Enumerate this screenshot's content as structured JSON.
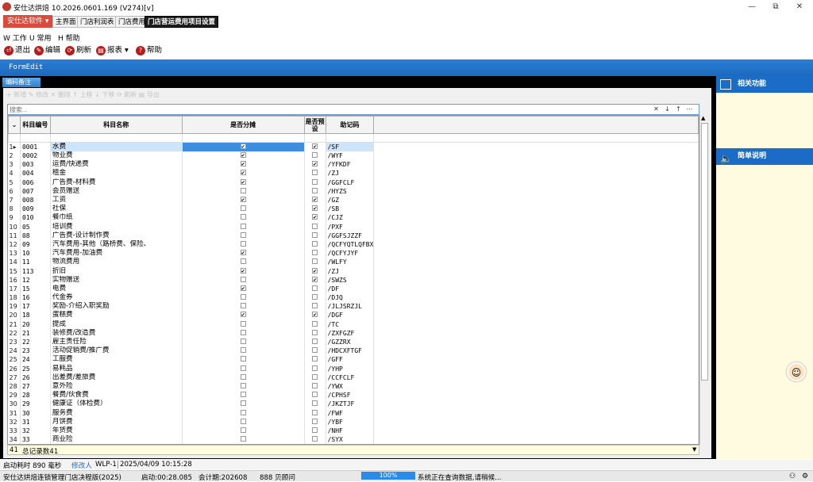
{
  "window": {
    "title": "安仕达烘焙  10.2026.0601.169 (V274)[v]",
    "minimize": "—",
    "maximize": "⧉",
    "close": "✕"
  },
  "tabs": {
    "menu_button": "安仕达软件 ▾",
    "items": [
      "主界面",
      "门店利润表",
      "门店费用",
      "门店营运费用项目设置"
    ]
  },
  "menubar": [
    "W 工作",
    "U 常用",
    "H 帮助"
  ],
  "toolbar": {
    "exit": "退出",
    "edit": "编辑",
    "refresh": "刷新",
    "report": "报表 ▾",
    "help": "帮助"
  },
  "form": {
    "title": "FormEdit",
    "doc_tab": "编码备注",
    "ghost_toolbar": "+ 新增  ✎ 修改  ✕ 删除  ↑ 上移  ↓ 下移  ⟳ 刷新  ▤ 导出",
    "search_placeholder": "搜索..."
  },
  "grid": {
    "columns": [
      "科目编号",
      "科目名称",
      "是否分摊",
      "是否预设",
      "助记码"
    ],
    "rows": [
      {
        "n": "1",
        "code": "0001",
        "name": "水费",
        "share": true,
        "preset": true,
        "mnem": "/SF"
      },
      {
        "n": "2",
        "code": "0002",
        "name": "物业费",
        "share": true,
        "preset": false,
        "mnem": "/WYF"
      },
      {
        "n": "3",
        "code": "003",
        "name": "运费/快递费",
        "share": true,
        "preset": true,
        "mnem": "/YFKDF"
      },
      {
        "n": "4",
        "code": "004",
        "name": "租金",
        "share": true,
        "preset": false,
        "mnem": "/ZJ"
      },
      {
        "n": "5",
        "code": "006",
        "name": "广告费-材料费",
        "share": true,
        "preset": false,
        "mnem": "/GGFCLF"
      },
      {
        "n": "6",
        "code": "007",
        "name": "会员赠送",
        "share": false,
        "preset": false,
        "mnem": "/HYZS"
      },
      {
        "n": "7",
        "code": "008",
        "name": "工资",
        "share": true,
        "preset": true,
        "mnem": "/GZ"
      },
      {
        "n": "8",
        "code": "009",
        "name": "社保",
        "share": false,
        "preset": true,
        "mnem": "/SB"
      },
      {
        "n": "9",
        "code": "010",
        "name": "餐巾纸",
        "share": false,
        "preset": true,
        "mnem": "/CJZ"
      },
      {
        "n": "10",
        "code": "05",
        "name": "培训费",
        "share": false,
        "preset": false,
        "mnem": "/PXF"
      },
      {
        "n": "11",
        "code": "08",
        "name": "广告费-设计制作费",
        "share": false,
        "preset": false,
        "mnem": "/GGFSJZZF"
      },
      {
        "n": "12",
        "code": "09",
        "name": "汽车费用-其他（路桥费、保险、",
        "share": false,
        "preset": false,
        "mnem": "/QCFYQTLQFBX"
      },
      {
        "n": "13",
        "code": "10",
        "name": "汽车费用-加油费",
        "share": true,
        "preset": false,
        "mnem": "/QCFYJYF"
      },
      {
        "n": "14",
        "code": "11",
        "name": "物流费用",
        "share": false,
        "preset": false,
        "mnem": "/WLFY"
      },
      {
        "n": "15",
        "code": "113",
        "name": "折旧",
        "share": true,
        "preset": true,
        "mnem": "/ZJ"
      },
      {
        "n": "16",
        "code": "12",
        "name": "实物赠送",
        "share": false,
        "preset": true,
        "mnem": "/SWZS"
      },
      {
        "n": "17",
        "code": "15",
        "name": "电费",
        "share": true,
        "preset": false,
        "mnem": "/DF"
      },
      {
        "n": "18",
        "code": "16",
        "name": "代金券",
        "share": false,
        "preset": false,
        "mnem": "/DJQ"
      },
      {
        "n": "19",
        "code": "17",
        "name": "奖励-介绍入职奖励",
        "share": false,
        "preset": false,
        "mnem": "/JLJSRZJL"
      },
      {
        "n": "20",
        "code": "18",
        "name": "蛋糕费",
        "share": true,
        "preset": true,
        "mnem": "/DGF"
      },
      {
        "n": "21",
        "code": "20",
        "name": "提成",
        "share": false,
        "preset": false,
        "mnem": "/TC"
      },
      {
        "n": "22",
        "code": "21",
        "name": "装修费/改造费",
        "share": false,
        "preset": false,
        "mnem": "/ZXFGZF"
      },
      {
        "n": "23",
        "code": "22",
        "name": "雇主责任险",
        "share": false,
        "preset": false,
        "mnem": "/GZZRX"
      },
      {
        "n": "24",
        "code": "23",
        "name": "活动促销费/推广费",
        "share": false,
        "preset": false,
        "mnem": "/HDCXFTGF"
      },
      {
        "n": "25",
        "code": "24",
        "name": "工服费",
        "share": false,
        "preset": false,
        "mnem": "/GFF"
      },
      {
        "n": "26",
        "code": "25",
        "name": "易耗品",
        "share": false,
        "preset": false,
        "mnem": "/YHP"
      },
      {
        "n": "27",
        "code": "26",
        "name": "出差费/差旅费",
        "share": false,
        "preset": false,
        "mnem": "/CCFCLF"
      },
      {
        "n": "28",
        "code": "27",
        "name": "意外险",
        "share": false,
        "preset": false,
        "mnem": "/YWX"
      },
      {
        "n": "29",
        "code": "28",
        "name": "餐费/伙食费",
        "share": false,
        "preset": false,
        "mnem": "/CPHSF"
      },
      {
        "n": "30",
        "code": "29",
        "name": "健康证（体检费）",
        "share": false,
        "preset": false,
        "mnem": "/JKZTJF"
      },
      {
        "n": "31",
        "code": "30",
        "name": "服务费",
        "share": false,
        "preset": false,
        "mnem": "/FWF"
      },
      {
        "n": "32",
        "code": "31",
        "name": "月饼费",
        "share": false,
        "preset": false,
        "mnem": "/YBF"
      },
      {
        "n": "33",
        "code": "32",
        "name": "年货费",
        "share": false,
        "preset": false,
        "mnem": "/NHF"
      },
      {
        "n": "34",
        "code": "33",
        "name": "商业险",
        "share": false,
        "preset": false,
        "mnem": "/SYX"
      }
    ],
    "footer_count": "41",
    "footer_label": "总记录数41"
  },
  "sidebar": {
    "related": "相关功能",
    "brief": "简单说明"
  },
  "status1": {
    "elapsed": "启动耗时  890  毫秒",
    "modifier_label": "修改人",
    "modifier": "WLP-1",
    "datetime": "2025/04/09 10:15:28"
  },
  "status2": {
    "app": "安仕达烘焙连锁管理门店决程版(2025)",
    "startup": "启动:00:28.085",
    "period": "会计期:202608",
    "user": "888 贝顾问",
    "progress": "100%",
    "message": "系统正在查询数据,请稍候..."
  }
}
